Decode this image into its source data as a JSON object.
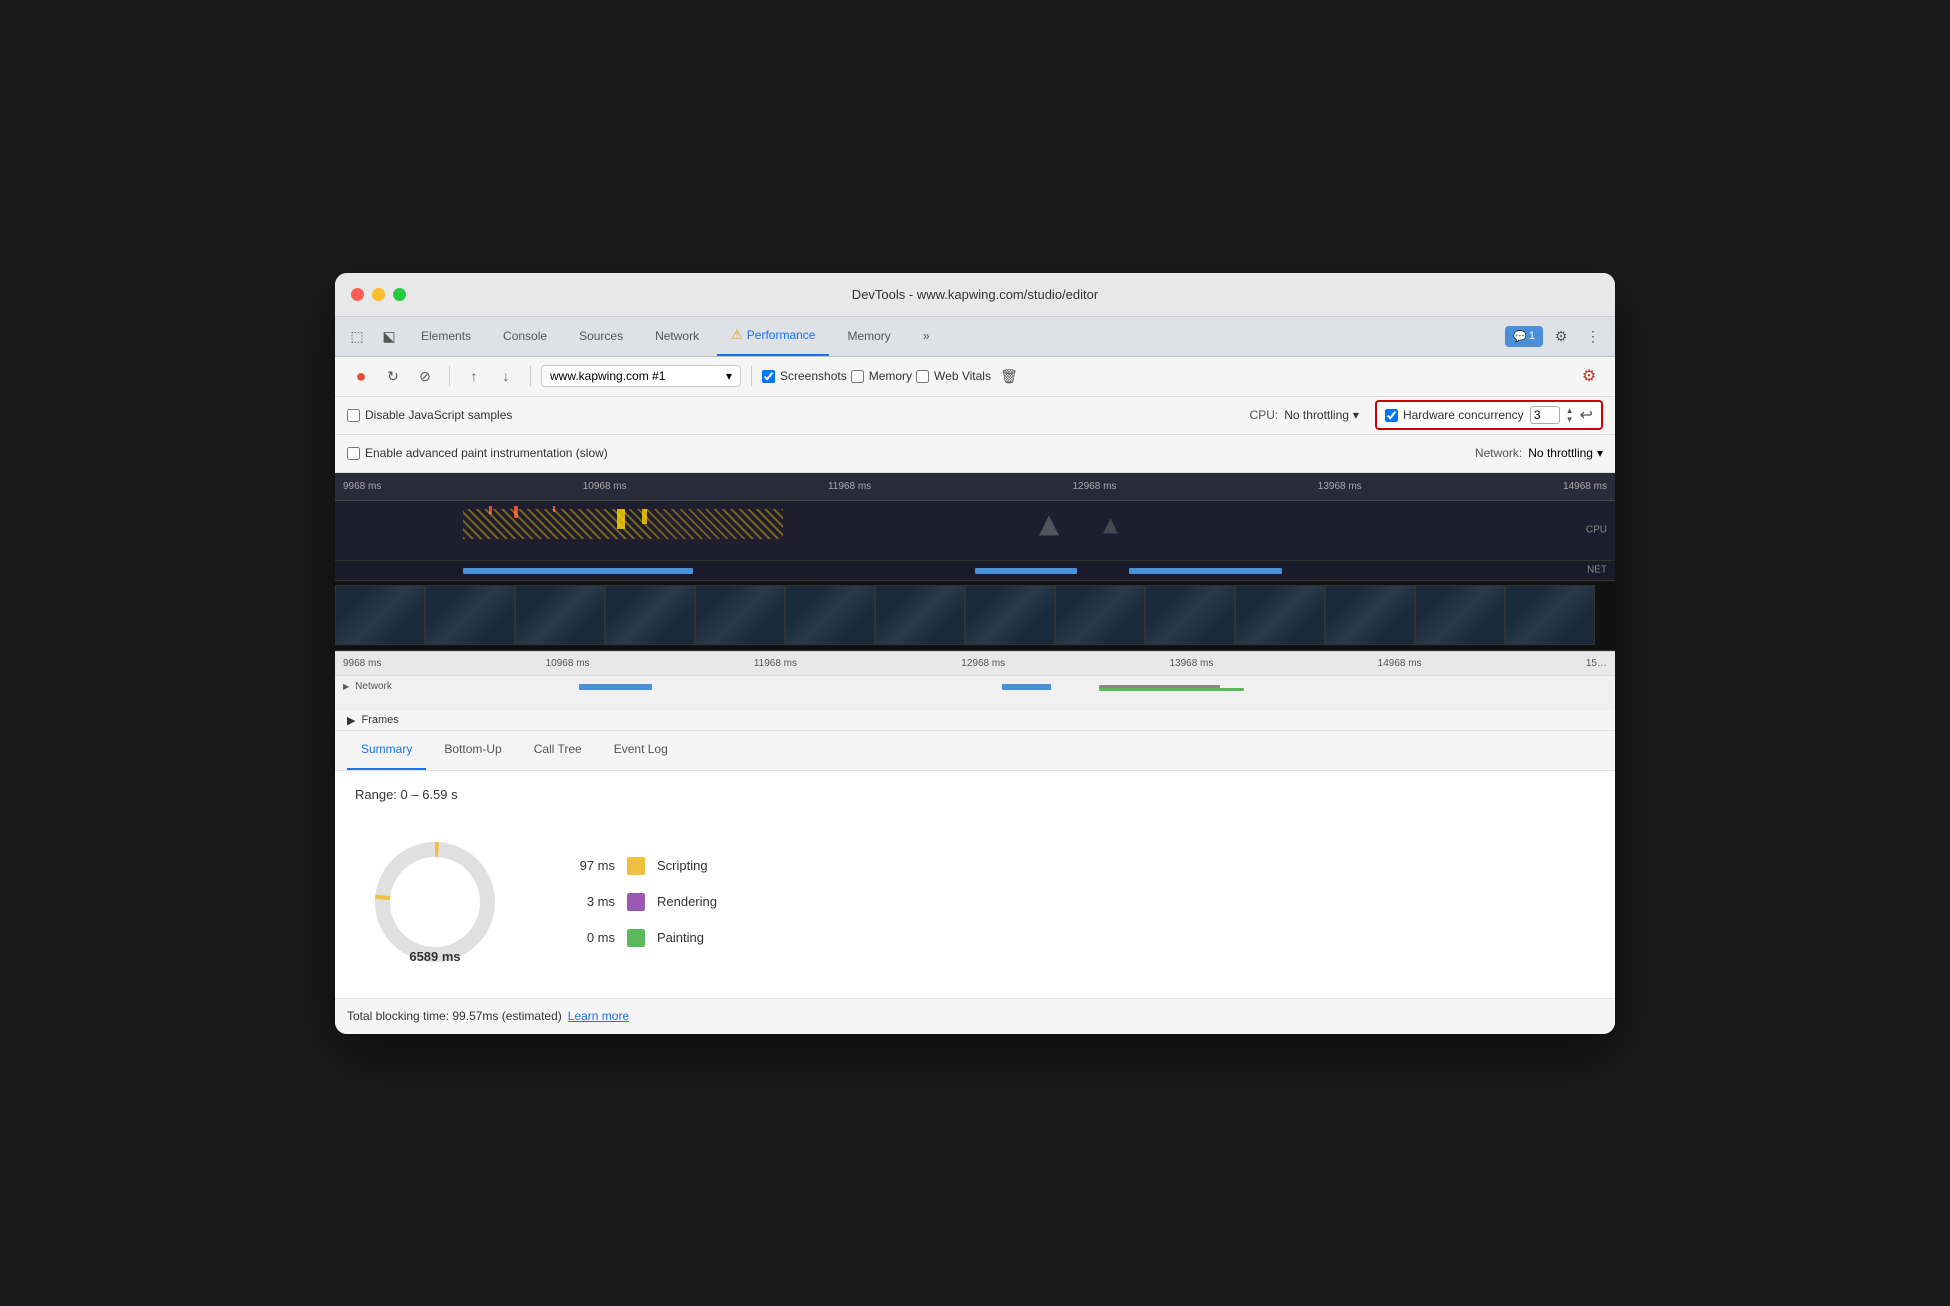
{
  "window": {
    "title": "DevTools - www.kapwing.com/studio/editor"
  },
  "tabs": {
    "items": [
      {
        "label": "Elements",
        "active": false
      },
      {
        "label": "Console",
        "active": false
      },
      {
        "label": "Sources",
        "active": false
      },
      {
        "label": "Network",
        "active": false
      },
      {
        "label": "Performance",
        "active": true,
        "warning": true
      },
      {
        "label": "Memory",
        "active": false
      }
    ],
    "more_label": "»",
    "badge_count": "1",
    "settings_icon": "⚙",
    "more_icon": "⋮"
  },
  "toolbar": {
    "record_icon": "●",
    "reload_icon": "↻",
    "stop_icon": "⊘",
    "upload_icon": "↑",
    "download_icon": "↓",
    "url_value": "www.kapwing.com #1",
    "screenshots_label": "Screenshots",
    "memory_label": "Memory",
    "web_vitals_label": "Web Vitals",
    "delete_icon": "🗑",
    "settings_icon": "⚙"
  },
  "settings": {
    "disable_js_label": "Disable JavaScript samples",
    "enable_paint_label": "Enable advanced paint instrumentation (slow)",
    "cpu_label": "CPU:",
    "cpu_value": "No throttling",
    "network_label": "Network:",
    "network_value": "No throttling",
    "hardware_concurrency_label": "Hardware concurrency",
    "hardware_concurrency_value": "3",
    "reset_icon": "↩"
  },
  "timeline": {
    "ruler_marks": [
      "9968 ms",
      "10968 ms",
      "11968 ms",
      "12968 ms",
      "13968 ms",
      "14968 ms"
    ],
    "lower_marks": [
      "9968 ms",
      "10968 ms",
      "11968 ms",
      "12968 ms",
      "13968 ms",
      "14968 ms",
      "15…"
    ],
    "cpu_label": "CPU",
    "net_label": "NET",
    "network_row": "Network",
    "frames_row": "Frames"
  },
  "bottom_panel": {
    "tabs": [
      {
        "label": "Summary",
        "active": true
      },
      {
        "label": "Bottom-Up",
        "active": false
      },
      {
        "label": "Call Tree",
        "active": false
      },
      {
        "label": "Event Log",
        "active": false
      }
    ],
    "range_text": "Range: 0 – 6.59 s",
    "total_blocking_time": "Total blocking time: 99.57ms (estimated)",
    "learn_more": "Learn more",
    "center_label": "6589 ms",
    "legend": [
      {
        "value": "97 ms",
        "label": "Scripting",
        "color": "#f0c040"
      },
      {
        "value": "3 ms",
        "label": "Rendering",
        "color": "#9b59b6"
      },
      {
        "value": "0 ms",
        "label": "Painting",
        "color": "#5cb85c"
      }
    ]
  }
}
